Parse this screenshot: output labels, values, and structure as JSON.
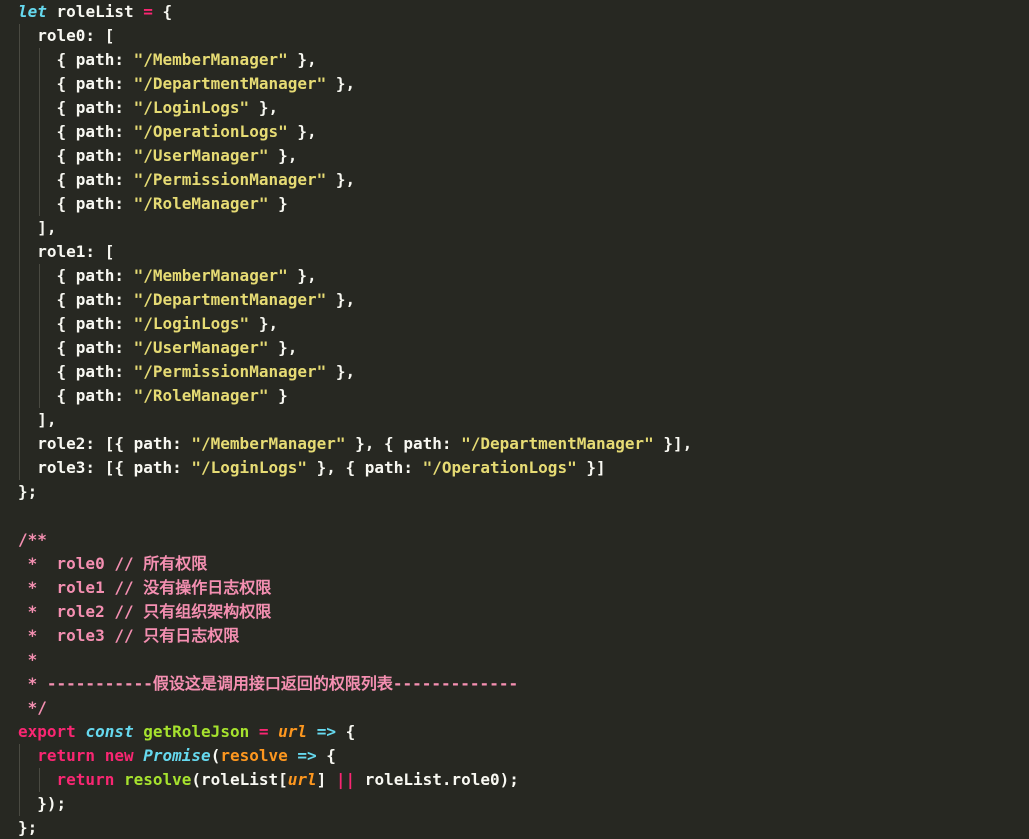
{
  "colors": {
    "background": "#272822",
    "text": "#f8f8f2",
    "keyword": "#f92672",
    "storage": "#66d9ef",
    "string": "#e6db74",
    "function": "#a6e22e",
    "parameter": "#fd971f",
    "comment": "#f48fb1"
  },
  "code": {
    "lines": [
      [
        [
          "let",
          "storage-italic"
        ],
        [
          " roleList ",
          "text"
        ],
        [
          "=",
          "keyword"
        ],
        [
          " {",
          "text"
        ]
      ],
      [
        [
          "  role0: [",
          "text"
        ]
      ],
      [
        [
          "    { path: ",
          "text"
        ],
        [
          "\"/MemberManager\"",
          "string"
        ],
        [
          " },",
          "text"
        ]
      ],
      [
        [
          "    { path: ",
          "text"
        ],
        [
          "\"/DepartmentManager\"",
          "string"
        ],
        [
          " },",
          "text"
        ]
      ],
      [
        [
          "    { path: ",
          "text"
        ],
        [
          "\"/LoginLogs\"",
          "string"
        ],
        [
          " },",
          "text"
        ]
      ],
      [
        [
          "    { path: ",
          "text"
        ],
        [
          "\"/OperationLogs\"",
          "string"
        ],
        [
          " },",
          "text"
        ]
      ],
      [
        [
          "    { path: ",
          "text"
        ],
        [
          "\"/UserManager\"",
          "string"
        ],
        [
          " },",
          "text"
        ]
      ],
      [
        [
          "    { path: ",
          "text"
        ],
        [
          "\"/PermissionManager\"",
          "string"
        ],
        [
          " },",
          "text"
        ]
      ],
      [
        [
          "    { path: ",
          "text"
        ],
        [
          "\"/RoleManager\"",
          "string"
        ],
        [
          " }",
          "text"
        ]
      ],
      [
        [
          "  ],",
          "text"
        ]
      ],
      [
        [
          "  role1: [",
          "text"
        ]
      ],
      [
        [
          "    { path: ",
          "text"
        ],
        [
          "\"/MemberManager\"",
          "string"
        ],
        [
          " },",
          "text"
        ]
      ],
      [
        [
          "    { path: ",
          "text"
        ],
        [
          "\"/DepartmentManager\"",
          "string"
        ],
        [
          " },",
          "text"
        ]
      ],
      [
        [
          "    { path: ",
          "text"
        ],
        [
          "\"/LoginLogs\"",
          "string"
        ],
        [
          " },",
          "text"
        ]
      ],
      [
        [
          "    { path: ",
          "text"
        ],
        [
          "\"/UserManager\"",
          "string"
        ],
        [
          " },",
          "text"
        ]
      ],
      [
        [
          "    { path: ",
          "text"
        ],
        [
          "\"/PermissionManager\"",
          "string"
        ],
        [
          " },",
          "text"
        ]
      ],
      [
        [
          "    { path: ",
          "text"
        ],
        [
          "\"/RoleManager\"",
          "string"
        ],
        [
          " }",
          "text"
        ]
      ],
      [
        [
          "  ],",
          "text"
        ]
      ],
      [
        [
          "  role2: [{ path: ",
          "text"
        ],
        [
          "\"/MemberManager\"",
          "string"
        ],
        [
          " }, { path: ",
          "text"
        ],
        [
          "\"/DepartmentManager\"",
          "string"
        ],
        [
          " }],",
          "text"
        ]
      ],
      [
        [
          "  role3: [{ path: ",
          "text"
        ],
        [
          "\"/LoginLogs\"",
          "string"
        ],
        [
          " }, { path: ",
          "text"
        ],
        [
          "\"/OperationLogs\"",
          "string"
        ],
        [
          " }]",
          "text"
        ]
      ],
      [
        [
          "};",
          "text"
        ]
      ],
      [],
      [
        [
          "/**",
          "comment"
        ]
      ],
      [
        [
          " *  role0 // 所有权限",
          "comment"
        ]
      ],
      [
        [
          " *  role1 // 没有操作日志权限",
          "comment"
        ]
      ],
      [
        [
          " *  role2 // 只有组织架构权限",
          "comment"
        ]
      ],
      [
        [
          " *  role3 // 只有日志权限",
          "comment"
        ]
      ],
      [
        [
          " *",
          "comment"
        ]
      ],
      [
        [
          " * -----------假设这是调用接口返回的权限列表-------------",
          "comment"
        ]
      ],
      [
        [
          " */",
          "comment"
        ]
      ],
      [
        [
          "export",
          "keyword"
        ],
        [
          " ",
          "text"
        ],
        [
          "const",
          "storage-italic"
        ],
        [
          " ",
          "text"
        ],
        [
          "getRoleJson",
          "function"
        ],
        [
          " ",
          "text"
        ],
        [
          "=",
          "keyword"
        ],
        [
          " ",
          "text"
        ],
        [
          "url",
          "parameter-italic"
        ],
        [
          " ",
          "text"
        ],
        [
          "=>",
          "storage"
        ],
        [
          " {",
          "text"
        ]
      ],
      [
        [
          "  ",
          "text"
        ],
        [
          "return",
          "keyword"
        ],
        [
          " ",
          "text"
        ],
        [
          "new",
          "keyword"
        ],
        [
          " ",
          "text"
        ],
        [
          "Promise",
          "storage-italic"
        ],
        [
          "(",
          "text"
        ],
        [
          "resolve",
          "parameter"
        ],
        [
          " ",
          "text"
        ],
        [
          "=>",
          "storage"
        ],
        [
          " {",
          "text"
        ]
      ],
      [
        [
          "    ",
          "text"
        ],
        [
          "return",
          "keyword"
        ],
        [
          " ",
          "text"
        ],
        [
          "resolve",
          "function"
        ],
        [
          "(roleList[",
          "text"
        ],
        [
          "url",
          "parameter-italic"
        ],
        [
          "] ",
          "text"
        ],
        [
          "||",
          "keyword"
        ],
        [
          " roleList.role0);",
          "text"
        ]
      ],
      [
        [
          "  });",
          "text"
        ]
      ],
      [
        [
          "};",
          "text"
        ]
      ]
    ]
  }
}
